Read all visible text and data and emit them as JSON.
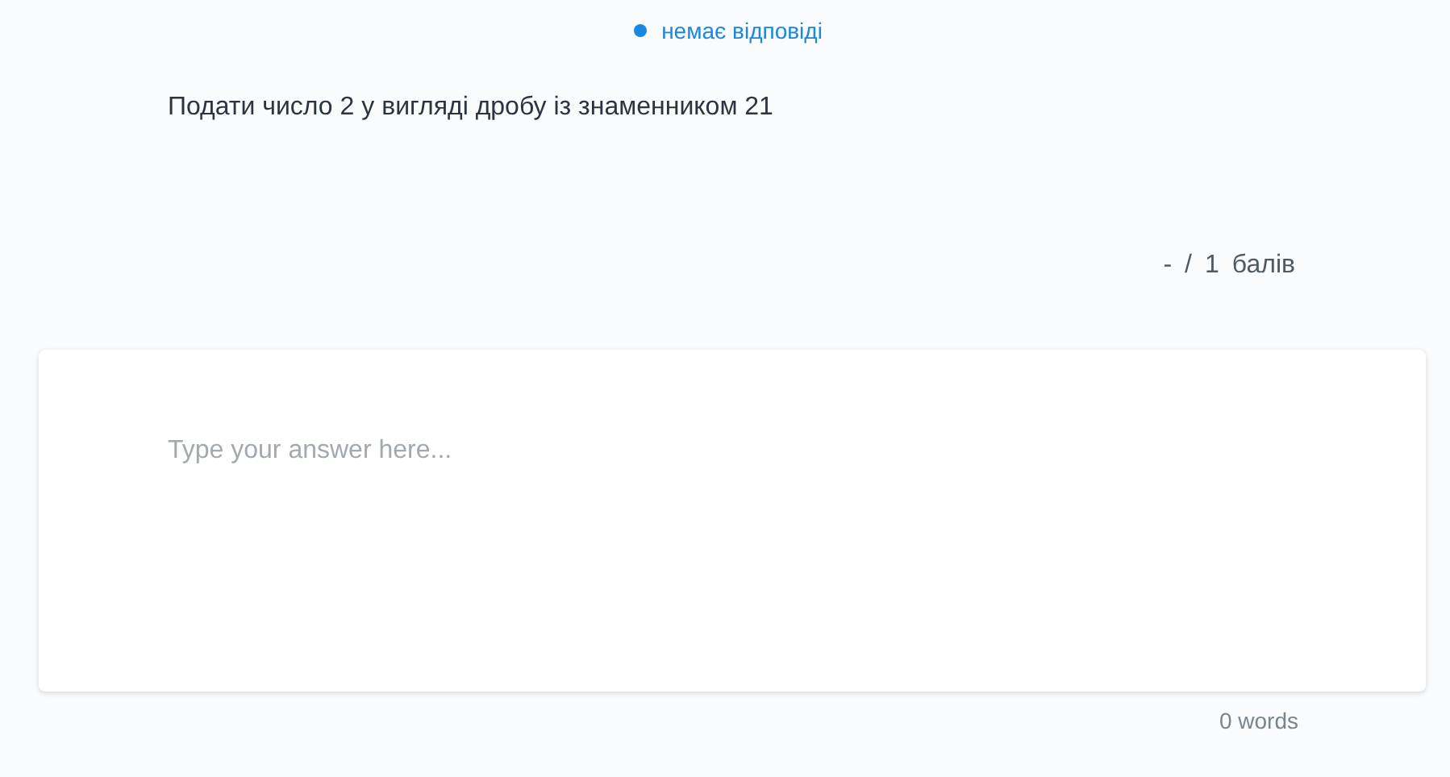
{
  "status": {
    "label": "немає відповіді",
    "color": "#1a87e0"
  },
  "question": {
    "text": "Подати число 2 у вигляді дробу із знаменником 21"
  },
  "score": {
    "earned": "-",
    "separator": "/",
    "max": "1",
    "unit": "балів"
  },
  "answer": {
    "placeholder": "Type your answer here..."
  },
  "word_count": "0 words"
}
